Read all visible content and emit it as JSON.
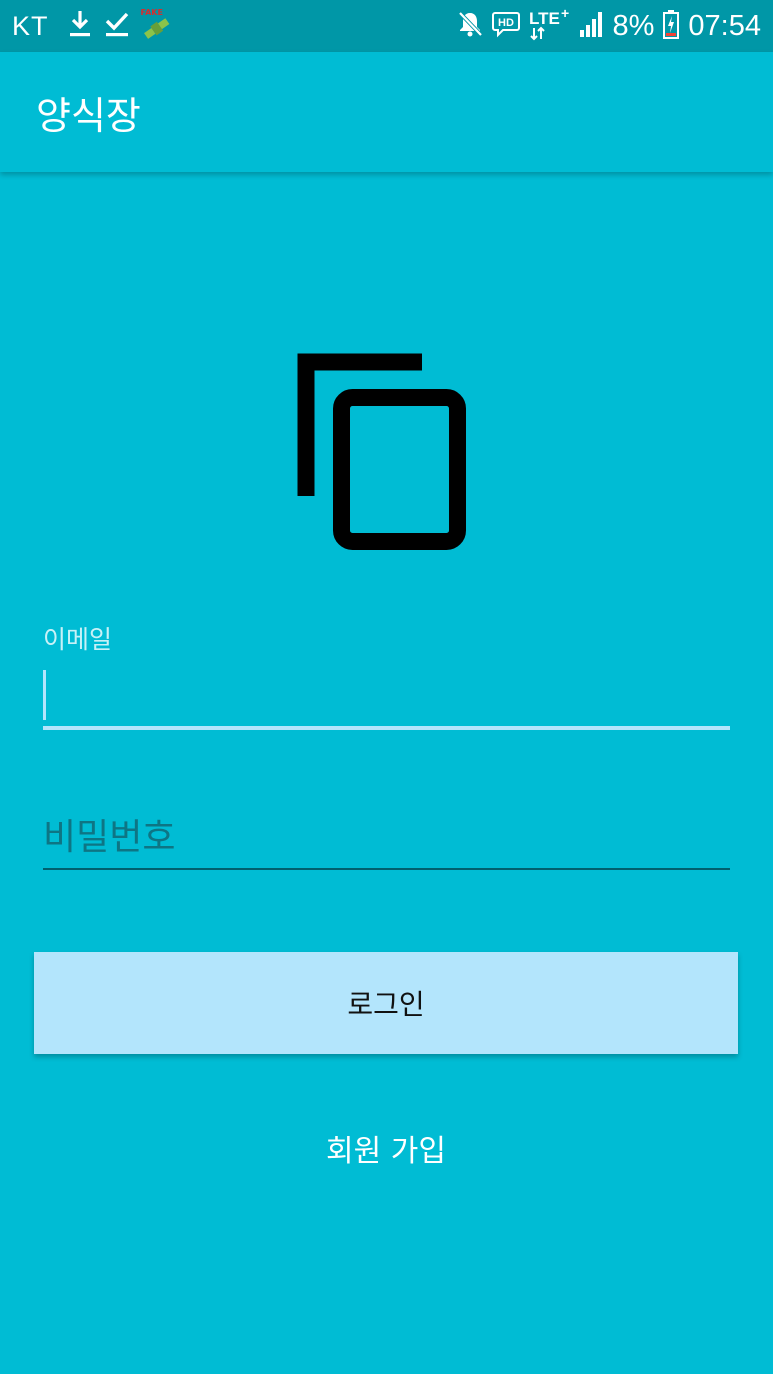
{
  "status_bar": {
    "carrier": "KT",
    "notification_icons": [
      "download-icon",
      "download-done-icon",
      "fake-gps-icon"
    ],
    "fake_gps_label": "FAKE",
    "system_icons": [
      "mute-icon",
      "hd-voice-icon",
      "lte-plus-icon",
      "signal-icon"
    ],
    "network_label": "LTE",
    "network_plus": "+",
    "hd_label": "HD",
    "battery_percent": "8%",
    "time": "07:54"
  },
  "app_bar": {
    "title": "양식장"
  },
  "logo": {
    "icon": "copy-icon"
  },
  "login_form": {
    "email_label": "이메일",
    "email_value": "",
    "password_placeholder": "비밀번호",
    "password_value": "",
    "login_button": "로그인",
    "signup_button": "회원 가입"
  },
  "colors": {
    "background": "#00BCD4",
    "status_bar": "#0097A7",
    "button": "#B3E5FC",
    "focused_underline": "#B3E5FC",
    "idle_underline": "#00606E"
  }
}
